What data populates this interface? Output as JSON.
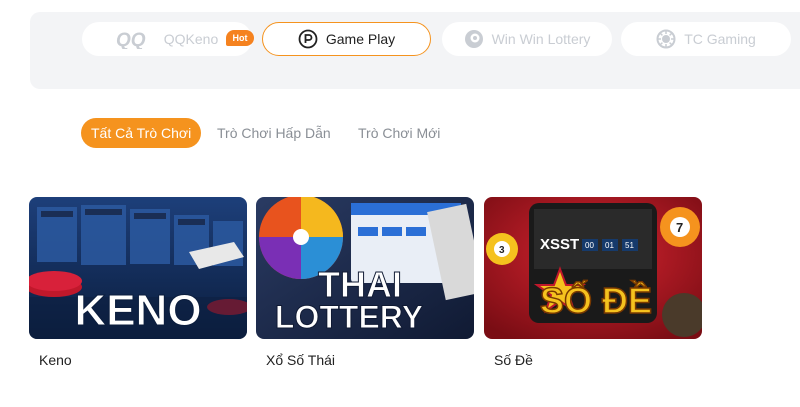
{
  "providers": [
    {
      "name": "QQKeno",
      "logo_text": "QQ",
      "icon": "qq-logo-icon",
      "active": false,
      "badge": "Hot"
    },
    {
      "name": "Game Play",
      "icon": "gameplay-logo-icon",
      "active": true
    },
    {
      "name": "Win Win Lottery",
      "icon": "winwin-logo-icon",
      "active": false
    },
    {
      "name": "TC Gaming",
      "icon": "tc-gaming-logo-icon",
      "active": false
    }
  ],
  "tabs": [
    {
      "label": "Tất Cả Trò Chơi",
      "active": true
    },
    {
      "label": "Trò Chơi Hấp Dẫn",
      "active": false
    },
    {
      "label": "Trò Chơi Mới",
      "active": false
    }
  ],
  "games": [
    {
      "title": "Keno",
      "banner_text": "KENO"
    },
    {
      "title": "Xổ Số Thái",
      "banner_text_1": "THAI",
      "banner_text_2": "LOTTERY"
    },
    {
      "title": "Số Đề",
      "banner_text": "SỐ ĐỀ",
      "screen_text": "XSST",
      "screen_digits": [
        "00",
        "01",
        "51"
      ],
      "ball_numbers": [
        "3",
        "7"
      ]
    }
  ],
  "colors": {
    "accent": "#f5931e",
    "badge": "#f5821f",
    "bar_bg": "#f3f4f6"
  }
}
